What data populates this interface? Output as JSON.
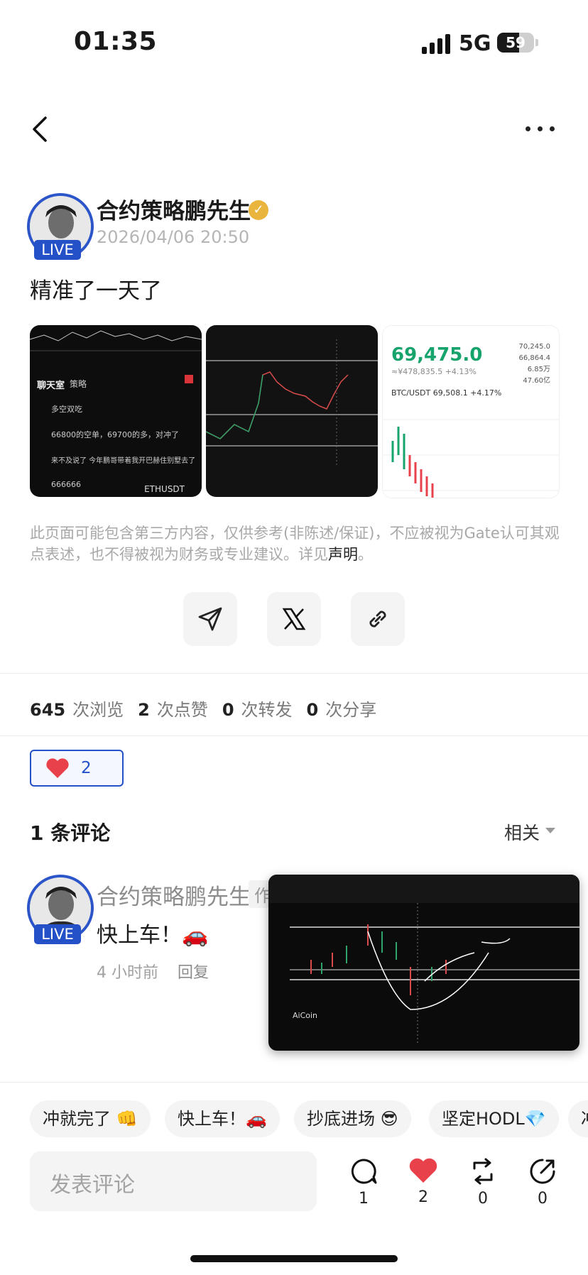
{
  "status_bar": {
    "time": "01:35",
    "network": "5G",
    "battery": "59"
  },
  "post": {
    "author": "合约策略鹏先生",
    "live_badge": "LIVE",
    "timestamp": "2026/04/06 20:50",
    "text": "精准了一天了",
    "thumbnails": {
      "chat_title": "聊天室",
      "chat_tab": "策略",
      "chat_lines": [
        "多空双吃",
        "66800的空单，69700的多，对冲了",
        "来不及说了  今年鹏哥带着我开巴赫住别墅去了",
        "666666"
      ],
      "chat_symbol": "ETHUSDT",
      "price": "69,475.0",
      "price_sub": "≈¥478,835.5  +4.13%",
      "pair": "BTC/USDT  69,508.1  +4.17%",
      "stats": [
        "70,245.0",
        "66,864.4",
        "6.85万",
        "47.60亿"
      ]
    }
  },
  "disclaimer": {
    "text": "此页面可能包含第三方内容，仅供参考(非陈述/保证)，不应被视为Gate认可其观点表述，也不得被视为财务或专业建议。详见",
    "link": "声明",
    "end": "。"
  },
  "share": {
    "icons": [
      "send-icon",
      "x-logo-icon",
      "link-icon"
    ]
  },
  "stats": {
    "views": "645",
    "views_label": "次浏览",
    "likes": "2",
    "likes_label": "次点赞",
    "reposts": "0",
    "reposts_label": "次转发",
    "shares": "0",
    "shares_label": "次分享"
  },
  "reaction": {
    "emoji": "heart",
    "count": "2"
  },
  "comments": {
    "title": "1 条评论",
    "sort": "相关",
    "items": [
      {
        "author": "合约策略鹏先生",
        "tag": "作",
        "live_badge": "LIVE",
        "text": "快上车！🚗",
        "time": "4 小时前",
        "reply": "回复",
        "chart_label": "AiCoin"
      }
    ]
  },
  "quick_replies": [
    "冲就完了 👊",
    "快上车！🚗",
    "抄底进场 😎",
    "坚定HODL💎",
    "冲"
  ],
  "bottom_bar": {
    "input_placeholder": "发表评论",
    "comment_count": "1",
    "like_count": "2",
    "repost_count": "0",
    "share_count": "0"
  },
  "colors": {
    "accent": "#2450c8",
    "like_red": "#e8414b",
    "price_green": "#16a36c"
  }
}
